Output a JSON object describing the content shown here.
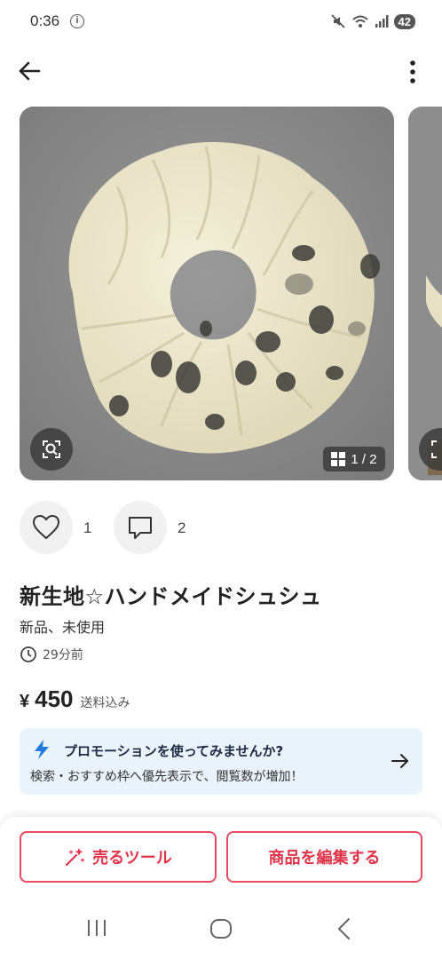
{
  "status_bar": {
    "time": "0:36",
    "info_glyph": "i",
    "battery": "42",
    "icons": [
      "mute-icon",
      "wifi-icon",
      "signal-icon"
    ]
  },
  "app_bar": {
    "icons": [
      "back-arrow-icon",
      "more-vert-icon"
    ]
  },
  "gallery": {
    "counter": "1 / 2",
    "icons": [
      "lens-search-icon",
      "grid-icon"
    ]
  },
  "reactions": {
    "likes": "1",
    "comments": "2"
  },
  "item": {
    "title": "新生地☆ハンドメイドシュシュ",
    "condition": "新品、未使用",
    "posted": "29分前",
    "price_symbol": "¥",
    "price": "450",
    "shipping": "送料込み"
  },
  "promo": {
    "title": "プロモーションを使ってみませんか?",
    "subtitle": "検索・おすすめ枠へ優先表示で、閲覧数が増加！"
  },
  "actions": {
    "sell_tools": "売るツール",
    "edit_item": "商品を編集する"
  },
  "colors": {
    "accent": "#e0344b",
    "promo_bg": "#e9f3fb",
    "promo_icon": "#1f7ae0"
  }
}
